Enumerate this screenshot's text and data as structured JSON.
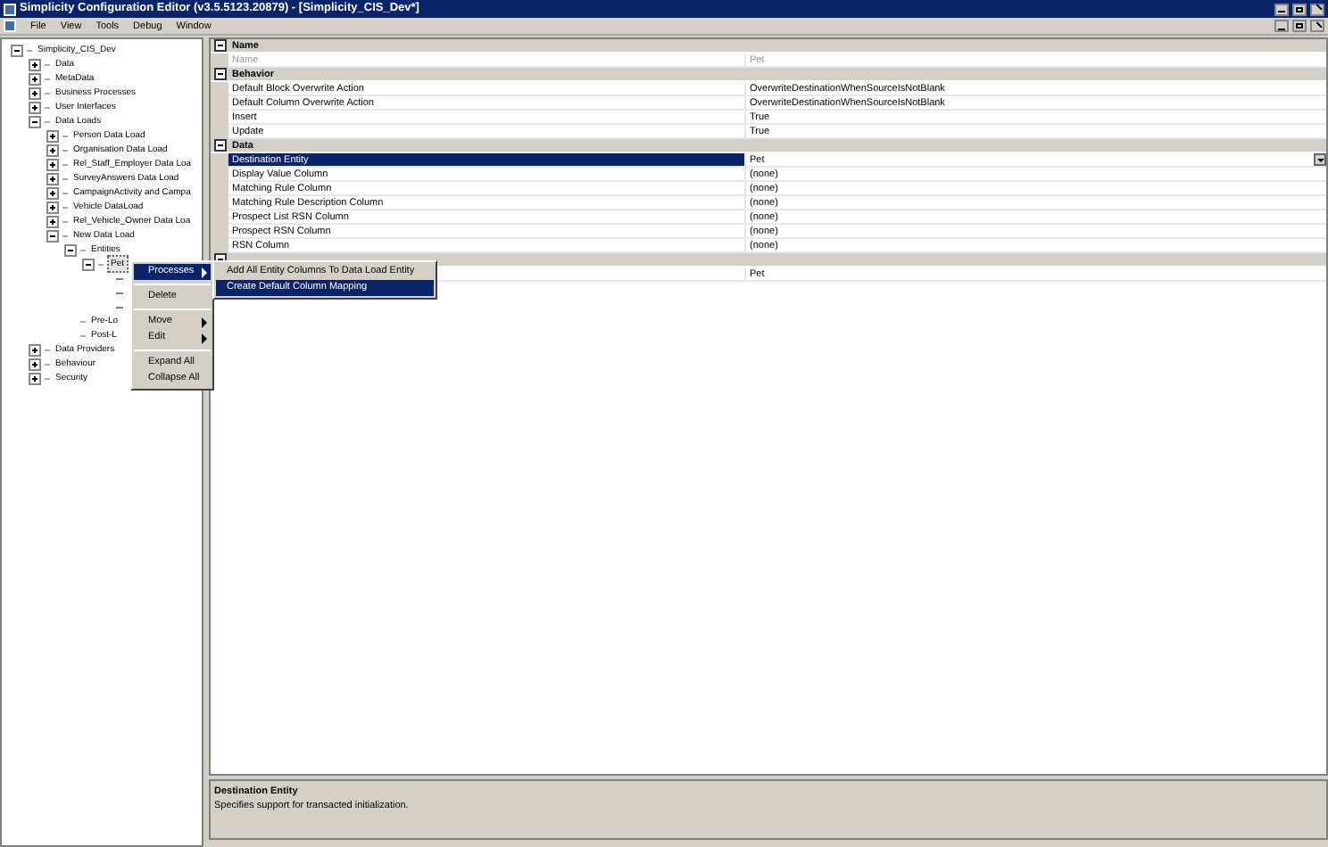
{
  "window": {
    "title": "Simplicity Configuration Editor (v3.5.5123.20879) - [Simplicity_CIS_Dev*]"
  },
  "menu": [
    "File",
    "View",
    "Tools",
    "Debug",
    "Window"
  ],
  "tree": [
    {
      "label": "Simplicity_CIS_Dev",
      "expanded": true,
      "selected": false,
      "children": [
        {
          "label": "Data",
          "expanded": false,
          "selected": false
        },
        {
          "label": "MetaData",
          "expanded": false,
          "selected": false
        },
        {
          "label": "Business Processes",
          "expanded": false,
          "selected": false
        },
        {
          "label": "User Interfaces",
          "expanded": false,
          "selected": false
        },
        {
          "label": "Data Loads",
          "expanded": true,
          "selected": false,
          "children": [
            {
              "label": "Person Data Load",
              "expanded": false,
              "selected": false
            },
            {
              "label": "Organisation Data Load",
              "expanded": false,
              "selected": false
            },
            {
              "label": "Rel_Staff_Employer Data Loa",
              "expanded": false,
              "selected": false
            },
            {
              "label": "SurveyAnswers Data Load",
              "expanded": false,
              "selected": false
            },
            {
              "label": "CampaignActivity and Campa",
              "expanded": false,
              "selected": false
            },
            {
              "label": "Vehicle DataLoad",
              "expanded": false,
              "selected": false
            },
            {
              "label": "Rel_Vehicle_Owner Data Loa",
              "expanded": false,
              "selected": false
            },
            {
              "label": "New Data Load",
              "expanded": true,
              "selected": false,
              "children": [
                {
                  "label": "Entities",
                  "expanded": true,
                  "selected": false,
                  "children": [
                    {
                      "label": "Pet",
                      "expanded": true,
                      "selected": true,
                      "children": [
                        {
                          "kind": "hidden"
                        },
                        {
                          "kind": "hidden"
                        },
                        {
                          "kind": "hidden"
                        }
                      ]
                    }
                  ]
                },
                {
                  "label": "Pre-Lo",
                  "selected": false
                },
                {
                  "label": "Post-L",
                  "selected": false
                }
              ]
            }
          ]
        },
        {
          "label": "Data Providers",
          "expanded": false,
          "selected": false
        },
        {
          "label": "Behaviour",
          "expanded": false,
          "selected": false
        },
        {
          "label": "Security",
          "expanded": false,
          "selected": false
        }
      ]
    }
  ],
  "context_menu": {
    "items": [
      {
        "kind": "item",
        "label": "Processes",
        "submenu": true,
        "selected": true
      },
      {
        "kind": "separator"
      },
      {
        "kind": "item",
        "label": "Delete",
        "submenu": false,
        "selected": false
      },
      {
        "kind": "separator"
      },
      {
        "kind": "item",
        "label": "Move",
        "submenu": true,
        "selected": false
      },
      {
        "kind": "item",
        "label": "Edit",
        "submenu": true,
        "selected": false
      },
      {
        "kind": "separator"
      },
      {
        "kind": "item",
        "label": "Expand All",
        "submenu": false,
        "selected": false
      },
      {
        "kind": "item",
        "label": "Collapse All",
        "submenu": false,
        "selected": false
      }
    ],
    "submenu": [
      {
        "label": "Add All Entity Columns To Data Load Entity",
        "selected": false
      },
      {
        "label": "Create Default Column Mapping",
        "selected": true
      }
    ]
  },
  "properties": [
    {
      "label": "Name",
      "expanded": true,
      "rows": [
        {
          "name": "Name",
          "value": "Pet",
          "disabled": true,
          "selected": false
        }
      ]
    },
    {
      "label": "Behavior",
      "expanded": true,
      "rows": [
        {
          "name": "Default Block Overwrite Action",
          "value": "OverwriteDestinationWhenSourceIsNotBlank",
          "disabled": false,
          "selected": false
        },
        {
          "name": "Default Column Overwrite Action",
          "value": "OverwriteDestinationWhenSourceIsNotBlank",
          "disabled": false,
          "selected": false
        },
        {
          "name": "Insert",
          "value": "True",
          "disabled": false,
          "selected": false
        },
        {
          "name": "Update",
          "value": "True",
          "disabled": false,
          "selected": false
        }
      ]
    },
    {
      "label": "Data",
      "expanded": true,
      "rows": [
        {
          "name": "Destination Entity",
          "value": "Pet",
          "disabled": false,
          "selected": true
        },
        {
          "name": "Display Value Column",
          "value": "(none)",
          "disabled": false,
          "selected": false
        },
        {
          "name": "Matching Rule Column",
          "value": "(none)",
          "disabled": false,
          "selected": false
        },
        {
          "name": "Matching Rule Description Column",
          "value": "(none)",
          "disabled": false,
          "selected": false
        },
        {
          "name": "Prospect List RSN Column",
          "value": "(none)",
          "disabled": false,
          "selected": false
        },
        {
          "name": "Prospect RSN Column",
          "value": "(none)",
          "disabled": false,
          "selected": false
        },
        {
          "name": "RSN Column",
          "value": "(none)",
          "disabled": false,
          "selected": false
        }
      ]
    },
    {
      "expanded": true,
      "rows": [
        {
          "value": "Pet",
          "disabled": false,
          "selected": false
        }
      ]
    }
  ],
  "description": {
    "title": "Destination Entity",
    "text": "Specifies support for transacted initialization."
  }
}
